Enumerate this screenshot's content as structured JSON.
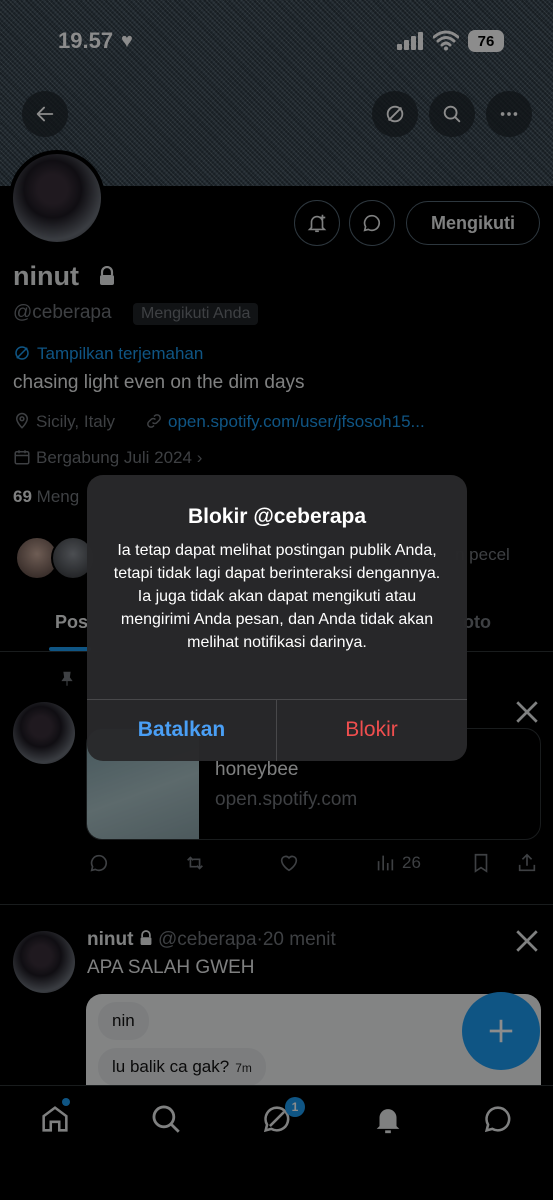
{
  "status_bar": {
    "time": "19.57",
    "battery": "76"
  },
  "profile": {
    "name": "ninut",
    "handle": "@ceberapa",
    "follows_you": "Mengikuti Anda",
    "follow_button": "Mengikuti",
    "translate": "Tampilkan terjemahan",
    "bio": "chasing light even on the dim days",
    "location": "Sicily, Italy",
    "link": "open.spotify.com/user/jfsosoh15...",
    "joined": "Bergabung Juli 2024",
    "following_count": "69",
    "following_label": "Meng",
    "followed_by_fragment": "n pecel"
  },
  "tabs": [
    {
      "label": "Pos",
      "active": true
    },
    {
      "label": "oto",
      "active": false
    }
  ],
  "post1": {
    "card_title": "honeybee",
    "card_domain": "open.spotify.com",
    "views": "26"
  },
  "post2": {
    "name": "ninut",
    "handle": "@ceberapa",
    "separator": "·",
    "time": "20 menit",
    "text": "APA SALAH GWEH",
    "chat": [
      {
        "text": "nin",
        "time": ""
      },
      {
        "text": "lu balik ca gak?",
        "time": "7m"
      }
    ]
  },
  "nav": {
    "messages_badge": "1"
  },
  "dialog": {
    "title": "Blokir @ceberapa",
    "message": "Ia tetap dapat melihat postingan publik Anda, tetapi tidak lagi dapat berinteraksi dengannya. Ia juga tidak akan dapat mengikuti atau mengirimi Anda pesan, dan Anda tidak akan melihat notifikasi darinya.",
    "cancel": "Batalkan",
    "confirm": "Blokir"
  },
  "colors": {
    "accent": "#1d9bf0",
    "danger": "#ef4e4e",
    "dialog_cancel": "#4a9ff5"
  }
}
